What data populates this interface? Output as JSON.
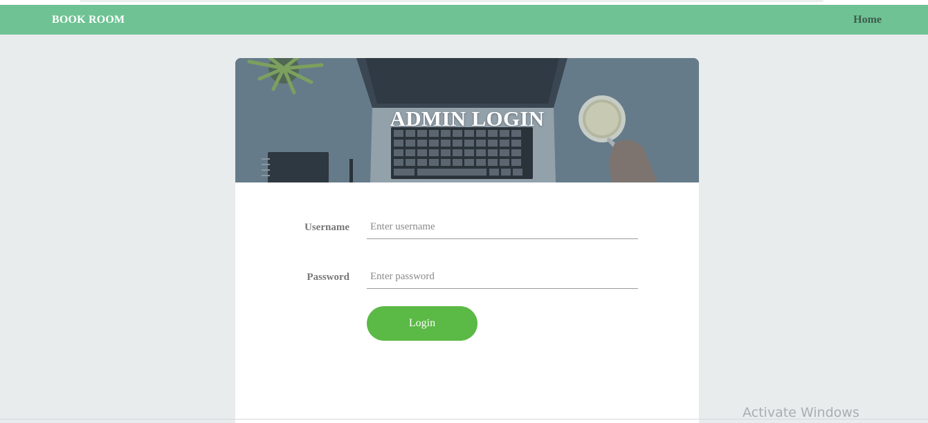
{
  "navbar": {
    "brand": "BOOK ROOM",
    "home_link": "Home"
  },
  "login_card": {
    "title": "ADMIN LOGIN",
    "username_label": "Username",
    "username_placeholder": "Enter username",
    "username_value": "",
    "password_label": "Password",
    "password_placeholder": "Enter password",
    "password_value": "",
    "login_button": "Login"
  },
  "os_overlay": {
    "watermark": "Activate Windows"
  },
  "colors": {
    "navbar_bg": "#6ec293",
    "page_bg": "#e9eced",
    "login_button_bg": "#5bb946",
    "hero_overlay": "#5f7382"
  },
  "icons": {
    "hero_image": "desk-laptop-coffee-photo"
  }
}
